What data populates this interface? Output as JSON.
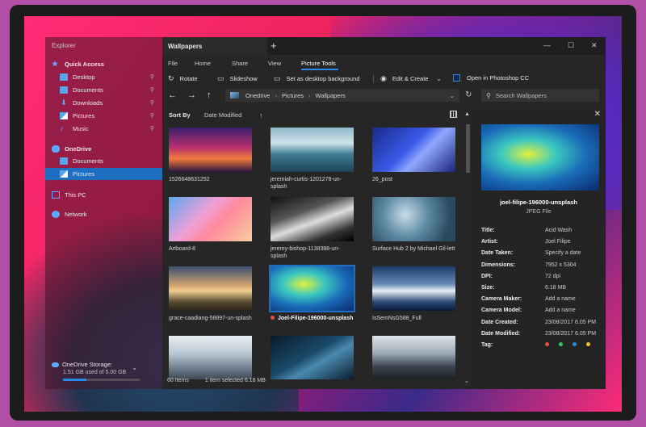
{
  "explorer": {
    "title": "Explorer",
    "items": [
      {
        "label": "Quick Access",
        "icon": "star-icon"
      },
      {
        "label": "Desktop",
        "icon": "folder-icon"
      },
      {
        "label": "Documents",
        "icon": "folder-icon"
      },
      {
        "label": "Downloads",
        "icon": "download-icon"
      },
      {
        "label": "Pictures",
        "icon": "pictures-icon"
      },
      {
        "label": "Music",
        "icon": "music-icon"
      },
      {
        "label": "OneDrive",
        "icon": "cloud-icon"
      },
      {
        "label": "Documents",
        "icon": "folder-icon"
      },
      {
        "label": "Pictures",
        "icon": "pictures-icon"
      },
      {
        "label": "This PC",
        "icon": "pc-icon"
      },
      {
        "label": "Network",
        "icon": "network-icon"
      }
    ],
    "storage": {
      "label": "OneDrive Storage:",
      "usage": "1.51 GB used of 5.00 GB",
      "fraction": 0.3
    }
  },
  "window": {
    "tab_title": "Wallpapers",
    "menus": [
      "File",
      "Home",
      "Share",
      "View",
      "Picture Tools"
    ],
    "ribbon": {
      "rotate": "Rotate",
      "slideshow": "Slideshow",
      "desktop_bg": "Set as desktop background",
      "edit_create": "Edit & Create",
      "photoshop": "Open in Photoshop CC"
    },
    "address": [
      "Onedrive",
      "Pictures",
      "Wallpapers"
    ],
    "search_placeholder": "Search Wallpapers",
    "sort": {
      "label": "Sort By",
      "value": "Date Modified"
    },
    "files": [
      "1526648631252",
      "jeremiah-curtis-1201278-un-splash",
      "26_post",
      "Artboard-8",
      "jeremy-bishop-1138388-un-splash",
      "Surface Hub 2 by Michael Gil-lett",
      "grace-caadiang-58897-un-splash",
      "Joel-Filipe-196000-unsplash",
      "IsSemNsG588_Full",
      "",
      "",
      ""
    ],
    "status": {
      "count": "60 Items",
      "selected": "1 item selected 6.18 MB"
    }
  },
  "details": {
    "name": "joel-filipe-196000-unsplash",
    "type": "JPEG File",
    "props": [
      {
        "k": "Title:",
        "v": "Acid Wash"
      },
      {
        "k": "Artist:",
        "v": "Joel Filipe"
      },
      {
        "k": "Date Taken:",
        "v": "Specify a date"
      },
      {
        "k": "Dimensions:",
        "v": "7952 x 5304"
      },
      {
        "k": "DPI:",
        "v": "72 dpi"
      },
      {
        "k": "Size:",
        "v": "6.18 MB"
      },
      {
        "k": "Camera Maker:",
        "v": "Add a name"
      },
      {
        "k": "Camera Model:",
        "v": "Add a name"
      },
      {
        "k": "Date Created:",
        "v": "23/08/2017 6.05 PM"
      },
      {
        "k": "Date Modified:",
        "v": "23/08/2017 6.05 PM"
      },
      {
        "k": "Tag:",
        "v": ""
      }
    ],
    "tag_colors": [
      "#e84c3d",
      "#3cc55a",
      "#2b8ae8",
      "#f0c030"
    ]
  }
}
